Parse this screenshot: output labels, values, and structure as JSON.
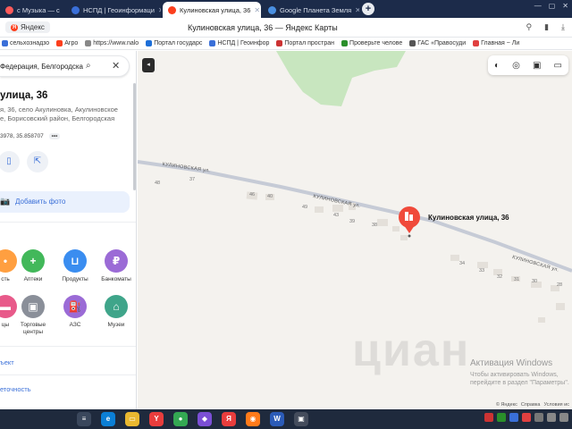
{
  "browser": {
    "tabs": [
      {
        "label": "с Музыка — с",
        "active": false,
        "icon_color": "#ff5a5a"
      },
      {
        "label": "НСПД | Геоинформаци",
        "active": false,
        "icon_color": "#3a6fd8"
      },
      {
        "label": "Кулиновская улица, 36",
        "active": true,
        "icon_color": "#fc3f1d"
      },
      {
        "label": "Google Планета Земля",
        "active": false,
        "icon_color": "#4a90e2"
      }
    ],
    "new_tab_label": "+",
    "address_home": "Яндекс",
    "page_title": "Кулиновская улица, 36 — Яндекс Карты",
    "bookmarks": [
      {
        "label": "сельхознадзо",
        "color": "#3a6fd8"
      },
      {
        "label": "Агро",
        "color": "#fc3f1d"
      },
      {
        "label": "https://www.nalo",
        "color": "#888"
      },
      {
        "label": "Портал государс",
        "color": "#1d6fd8"
      },
      {
        "label": "НСПД | Геоинфор",
        "color": "#3a6fd8"
      },
      {
        "label": "Портал простран",
        "color": "#c33"
      },
      {
        "label": "Проверьте челове",
        "color": "#2a8f2a"
      },
      {
        "label": "ГАС «Правосуди",
        "color": "#555"
      },
      {
        "label": "Главная ~ Ли",
        "color": "#e04040"
      }
    ]
  },
  "sidebar": {
    "search_text": "Федерация, Белгородска",
    "title": "улица, 36",
    "address": "я, 36, село Акулиновка, Акулиновское е, Борисовский район, Белгородская",
    "coords": "3978, 35.858707",
    "coords_more": "•••",
    "add_photo": "Добавить фото",
    "categories": [
      {
        "label": "сть",
        "icon": "pin",
        "color": "#ff9f40"
      },
      {
        "label": "Аптеки",
        "icon": "+",
        "color": "#42b85a"
      },
      {
        "label": "Продукты",
        "icon": "basket",
        "color": "#3a8df0"
      },
      {
        "label": "Банкоматы",
        "icon": "₽",
        "color": "#9b6bd6"
      },
      {
        "label": "цы",
        "icon": "bed",
        "color": "#e85a8a"
      },
      {
        "label": "Торговые центры",
        "icon": "bag",
        "color": "#8a8f99"
      },
      {
        "label": "АЗС",
        "icon": "fuel",
        "color": "#9b6bd6"
      },
      {
        "label": "Музеи",
        "icon": "museum",
        "color": "#3fa58a"
      }
    ],
    "link_object": "ъект",
    "link_accuracy": "еточность"
  },
  "map": {
    "marker_label": "Кулиновская улица, 36",
    "street_name": "КУЛИНОВСКАЯ ул.",
    "house_numbers": [
      {
        "n": "48"
      },
      {
        "n": "37"
      },
      {
        "n": "46"
      },
      {
        "n": "40"
      },
      {
        "n": "49"
      },
      {
        "n": "43"
      },
      {
        "n": "39"
      },
      {
        "n": "38"
      },
      {
        "n": "34"
      },
      {
        "n": "33"
      },
      {
        "n": "32"
      },
      {
        "n": "31"
      },
      {
        "n": "30"
      },
      {
        "n": "28"
      }
    ],
    "watermark": "циан",
    "activate_title": "Активация Windows",
    "activate_sub": "Чтобы активировать Windows, перейдите в раздел \"Параметры\".",
    "footer": [
      "© Яндекс",
      "Справка",
      "Условия ис"
    ]
  },
  "taskbar": {
    "apps": [
      {
        "label": "≡",
        "color": "#3a475c"
      },
      {
        "label": "e",
        "color": "#0b7fd6"
      },
      {
        "label": "▭",
        "color": "#e9b830"
      },
      {
        "label": "Y",
        "color": "#e83d3d"
      },
      {
        "label": "●",
        "color": "#34a853"
      },
      {
        "label": "◆",
        "color": "#7b4fd6"
      },
      {
        "label": "Я",
        "color": "#e83d3d"
      },
      {
        "label": "◉",
        "color": "#ff7a1a"
      },
      {
        "label": "W",
        "color": "#2b5bb8"
      },
      {
        "label": "▣",
        "color": "#444c5c"
      }
    ]
  }
}
